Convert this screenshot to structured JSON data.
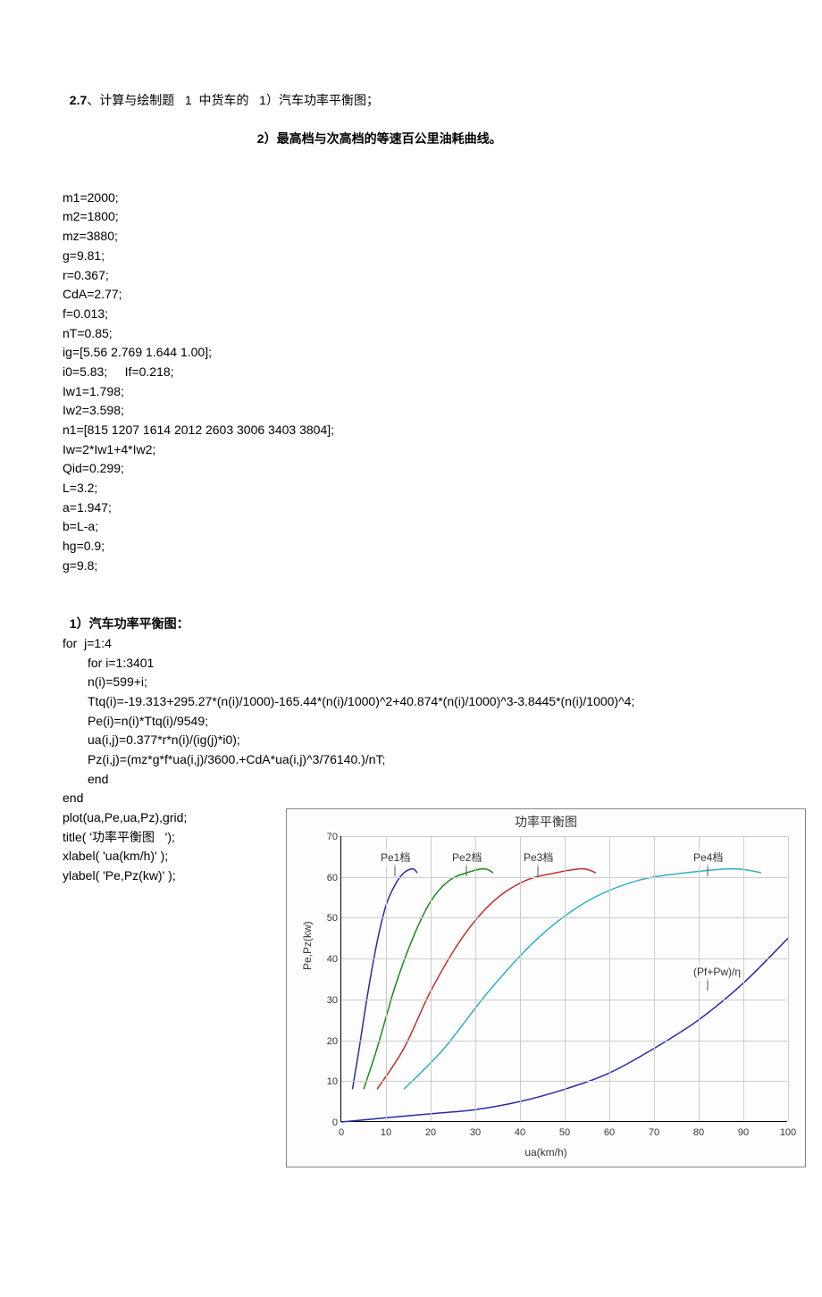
{
  "header": {
    "prefix": "2.7",
    "line1_rest": "、计算与绘制题   1  中货车的   1）汽车功率平衡图；",
    "line2": "2）最高档与次高档的等速百公里油耗曲线。"
  },
  "code_block1": [
    "m1=2000;",
    "m2=1800;",
    "mz=3880;",
    "g=9.81;",
    "r=0.367;",
    "CdA=2.77;",
    "f=0.013;",
    "nT=0.85;",
    "ig=[5.56 2.769 1.644 1.00];",
    "i0=5.83;     If=0.218;",
    "Iw1=1.798;",
    "Iw2=3.598;",
    "n1=[815 1207 1614 2012 2603 3006 3403 3804];",
    "Iw=2*Iw1+4*Iw2;",
    "Qid=0.299;",
    "L=3.2;",
    "a=1.947;",
    "b=L-a;",
    "hg=0.9;",
    "g=9.8;"
  ],
  "section1_title": "1）汽车功率平衡图：",
  "code_block2_outer_open": "for  j=1:4",
  "code_block2_inner": [
    "for i=1:3401",
    "n(i)=599+i;",
    "Ttq(i)=-19.313+295.27*(n(i)/1000)-165.44*(n(i)/1000)^2+40.874*(n(i)/1000)^3-3.8445*(n(i)/1000)^4;",
    "Pe(i)=n(i)*Ttq(i)/9549;",
    "ua(i,j)=0.377*r*n(i)/(ig(j)*i0);",
    "Pz(i,j)=(mz*g*f*ua(i,j)/3600.+CdA*ua(i,j)^3/76140.)/nT;",
    "end"
  ],
  "code_block2_outer_close": "end",
  "code_block3": [
    "plot(ua,Pe,ua,Pz),grid;",
    "title( '功率平衡图   ');",
    "xlabel( 'ua(km/h)' );",
    "ylabel( 'Pe,Pz(kw)' );"
  ],
  "chart_data": {
    "type": "line",
    "title": "功率平衡图",
    "xlabel": "ua(km/h)",
    "ylabel": "Pe,Pz(kw)",
    "xlim": [
      0,
      100
    ],
    "ylim": [
      0,
      70
    ],
    "xticks": [
      0,
      10,
      20,
      30,
      40,
      50,
      60,
      70,
      80,
      90,
      100
    ],
    "yticks": [
      0,
      10,
      20,
      30,
      40,
      50,
      60,
      70
    ],
    "annotations": [
      "Pe1档",
      "Pe2档",
      "Pe3档",
      "Pe4档",
      "(Pf+Pw)/η"
    ],
    "series": [
      {
        "name": "Pe1档",
        "color": "#2a2aa8",
        "x": [
          2.5,
          4,
          6,
          8,
          10,
          12,
          14,
          16,
          17
        ],
        "y": [
          8,
          18,
          32,
          44,
          53,
          58,
          61,
          62,
          61
        ]
      },
      {
        "name": "Pe2档",
        "color": "#1a8a1a",
        "x": [
          5,
          8,
          12,
          16,
          20,
          24,
          28,
          32,
          34
        ],
        "y": [
          8,
          18,
          33,
          45,
          54,
          59,
          61,
          62,
          61
        ]
      },
      {
        "name": "Pe3档",
        "color": "#c03030",
        "x": [
          8,
          14,
          20,
          27,
          34,
          41,
          48,
          54,
          57
        ],
        "y": [
          8,
          18,
          32,
          45,
          54,
          59,
          61,
          62,
          61
        ]
      },
      {
        "name": "Pe4档",
        "color": "#30b0c0",
        "x": [
          14,
          23,
          33,
          44,
          55,
          66,
          77,
          88,
          94
        ],
        "y": [
          8,
          18,
          32,
          45,
          54,
          59,
          61,
          62,
          61
        ]
      },
      {
        "name": "(Pf+Pw)/η",
        "color": "#2a2aa8",
        "x": [
          0,
          10,
          20,
          30,
          40,
          50,
          60,
          70,
          80,
          90,
          100
        ],
        "y": [
          0,
          1,
          2,
          3,
          5,
          8,
          12,
          18,
          25,
          34,
          45
        ]
      }
    ]
  }
}
